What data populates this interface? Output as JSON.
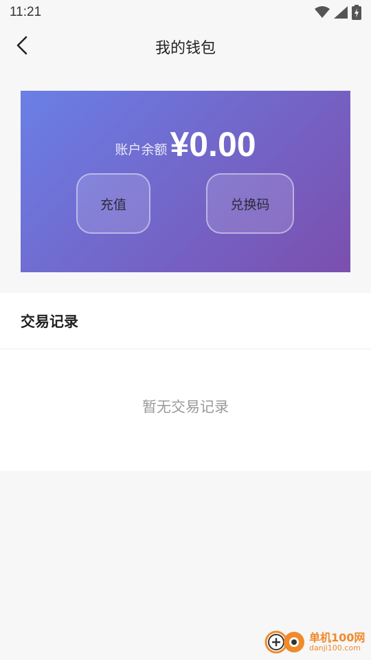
{
  "status_bar": {
    "time": "11:21"
  },
  "nav": {
    "title": "我的钱包"
  },
  "wallet": {
    "balance_label": "账户余额",
    "balance_amount": "¥0.00",
    "recharge_label": "充值",
    "redeem_label": "兑换码"
  },
  "transactions": {
    "title": "交易记录",
    "empty_text": "暂无交易记录"
  },
  "watermark": {
    "brand": "单机100网",
    "url": "danji100.com"
  },
  "colors": {
    "card_gradient_start": "#6a7fe6",
    "card_gradient_end": "#7b4fae",
    "watermark": "#f08a2a"
  }
}
